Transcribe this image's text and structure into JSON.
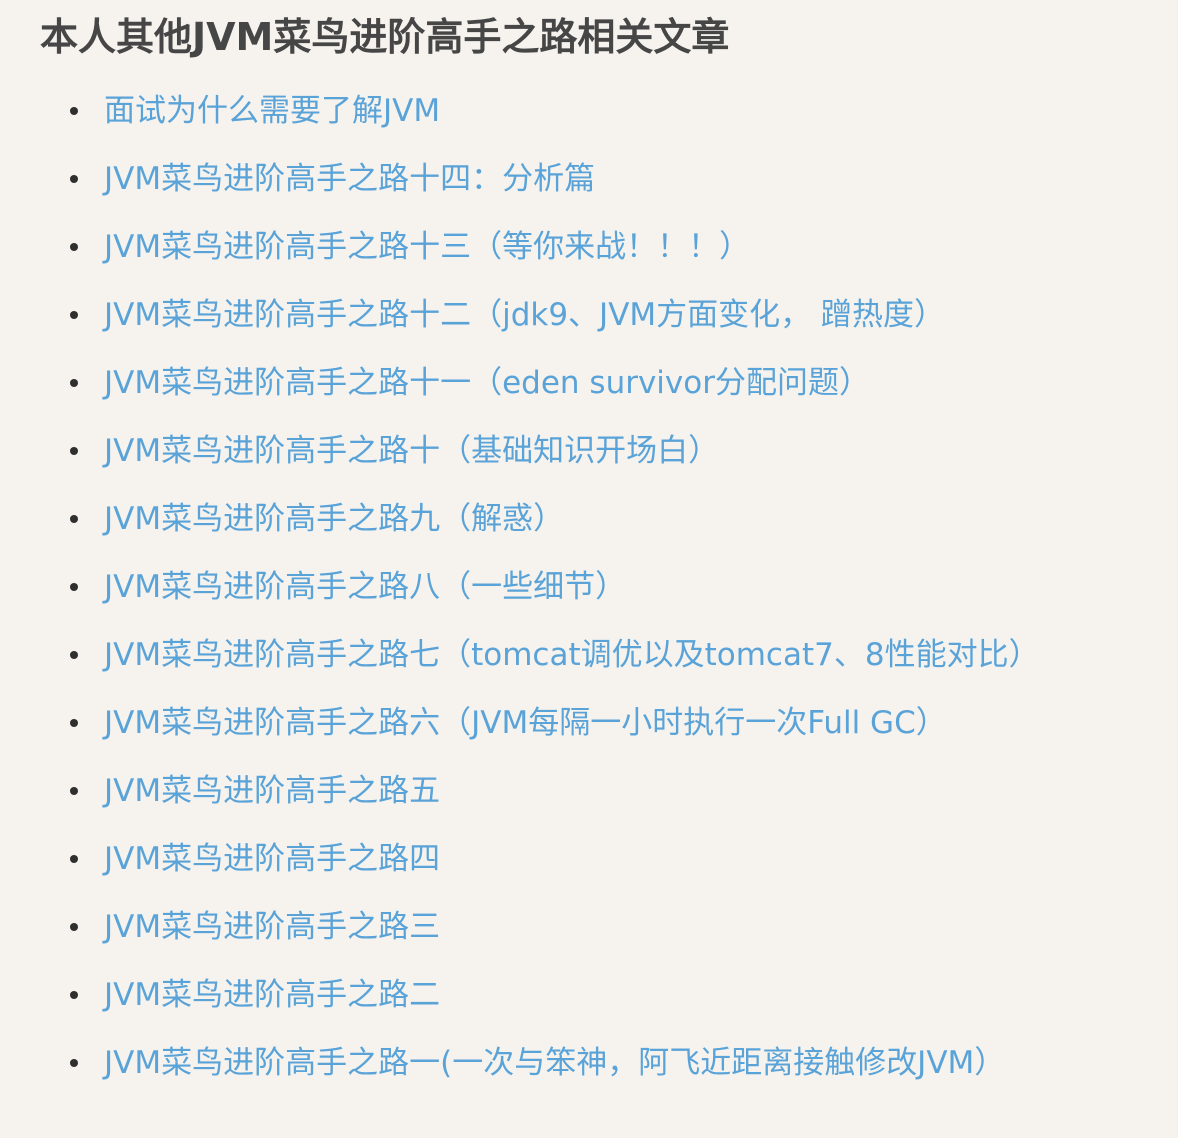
{
  "page": {
    "title": "本人其他JVM菜鸟进阶高手之路相关文章"
  },
  "articles": [
    {
      "label": "面试为什么需要了解JVM"
    },
    {
      "label": "JVM菜鸟进阶高手之路十四：分析篇"
    },
    {
      "label": "JVM菜鸟进阶高手之路十三（等你来战！！！）"
    },
    {
      "label": "JVM菜鸟进阶高手之路十二（jdk9、JVM方面变化， 蹭热度）"
    },
    {
      "label": "JVM菜鸟进阶高手之路十一（eden survivor分配问题）"
    },
    {
      "label": "JVM菜鸟进阶高手之路十（基础知识开场白）"
    },
    {
      "label": "JVM菜鸟进阶高手之路九（解惑）"
    },
    {
      "label": "JVM菜鸟进阶高手之路八（一些细节）"
    },
    {
      "label": "JVM菜鸟进阶高手之路七（tomcat调优以及tomcat7、8性能对比）"
    },
    {
      "label": "JVM菜鸟进阶高手之路六（JVM每隔一小时执行一次Full GC）"
    },
    {
      "label": "JVM菜鸟进阶高手之路五"
    },
    {
      "label": "JVM菜鸟进阶高手之路四"
    },
    {
      "label": "JVM菜鸟进阶高手之路三"
    },
    {
      "label": "JVM菜鸟进阶高手之路二"
    },
    {
      "label": "JVM菜鸟进阶高手之路一(一次与笨神，阿飞近距离接触修改JVM）"
    }
  ],
  "colors": {
    "background": "#f6f3ee",
    "title": "#464646",
    "link": "#5aa3d8",
    "bullet": "#2f2f2f"
  }
}
